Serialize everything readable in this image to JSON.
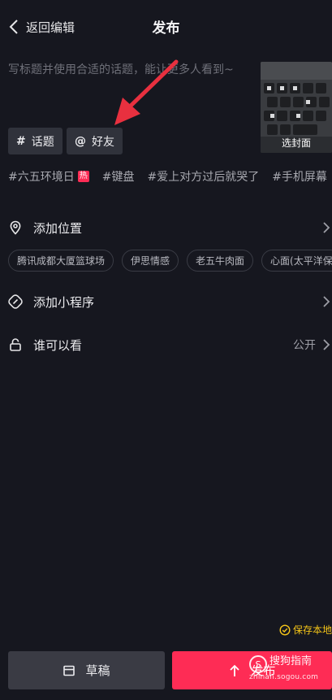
{
  "header": {
    "back_label": "返回编辑",
    "title": "发布"
  },
  "caption": {
    "placeholder": "写标题并使用合适的话题，能让更多人看到~"
  },
  "cover": {
    "label": "选封面"
  },
  "chips": {
    "topic_symbol": "#",
    "topic_label": "话题",
    "friend_symbol": "@",
    "friend_label": "好友"
  },
  "trending_tags": [
    {
      "text": "#六五环境日",
      "badge": "热"
    },
    {
      "text": "#键盘"
    },
    {
      "text": "#爱上对方过后就哭了"
    },
    {
      "text": "#手机屏幕"
    }
  ],
  "location": {
    "label": "添加位置",
    "suggestions": [
      "腾讯成都大厦篮球场",
      "伊思情感",
      "老五牛肉面",
      "心面(太平洋保"
    ]
  },
  "mini_program": {
    "label": "添加小程序"
  },
  "visibility": {
    "label": "谁可以看",
    "value": "公开"
  },
  "save_local": {
    "label": "保存本地"
  },
  "buttons": {
    "draft_label": "草稿",
    "publish_label": "发布"
  },
  "watermark": {
    "main": "搜狗指南",
    "url": "zhinan.sogou.com",
    "logo_char": "S"
  },
  "colors": {
    "background": "#16171f",
    "accent": "#fe2c55",
    "chip_bg": "#30323b",
    "save_local": "#f5c518",
    "arrow": "#e8303f"
  }
}
